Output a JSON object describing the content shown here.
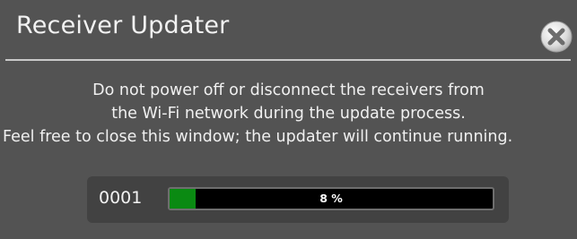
{
  "window": {
    "title": "Receiver Updater",
    "close_icon": "close-circle-icon"
  },
  "message": {
    "line1": "Do not power off or disconnect the receivers from",
    "line2": "the Wi-Fi network during the update process.",
    "line3": "Feel free to close this window; the updater will continue running."
  },
  "progress": {
    "receiver_id": "0001",
    "percent": 8,
    "label": "8 %",
    "fill_color": "#0a8a12"
  },
  "colors": {
    "background": "#535353",
    "panel": "#424242",
    "text": "#f0f0f0"
  }
}
